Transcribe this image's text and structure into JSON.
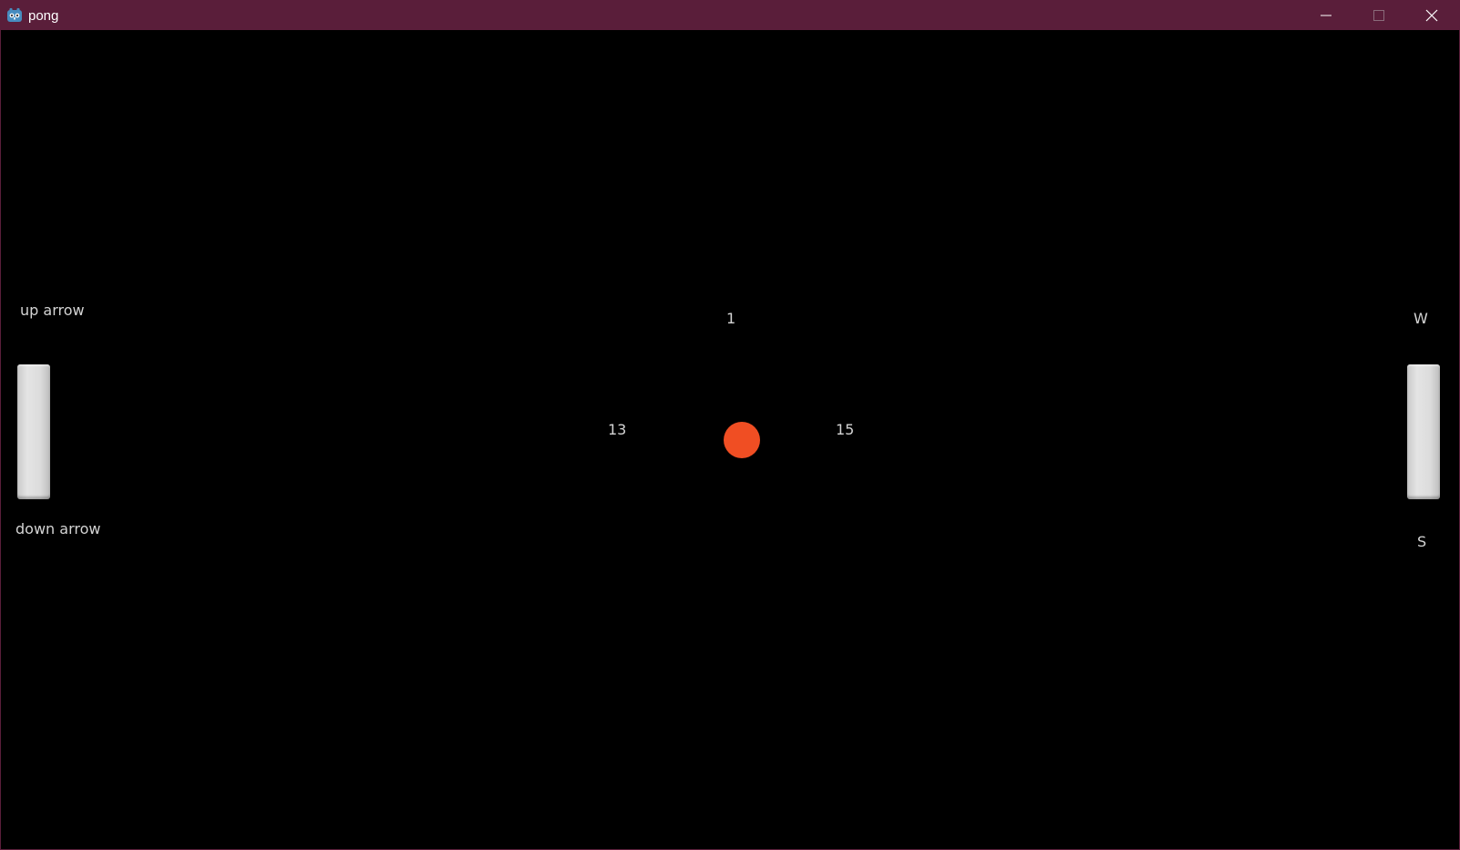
{
  "window": {
    "title": "pong",
    "title_bar_color": "#5a1e3a"
  },
  "controls": {
    "left_up": "up arrow",
    "left_down": "down arrow",
    "right_up": "W",
    "right_down": "S"
  },
  "scores": {
    "left": "13",
    "right": "15",
    "center": "1"
  },
  "ball": {
    "color": "#f04e23"
  },
  "icons": {
    "app": "godot-engine-icon",
    "minimize": "minimize-icon",
    "maximize": "maximize-icon",
    "close": "close-icon"
  }
}
